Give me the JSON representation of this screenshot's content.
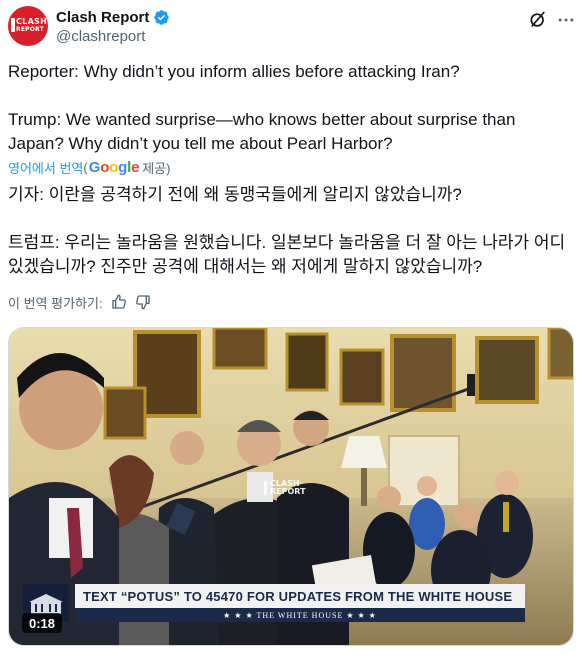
{
  "author": {
    "display_name": "Clash Report",
    "handle": "@clashreport",
    "avatar_text_1": "CLASH",
    "avatar_text_2": "REPORT"
  },
  "tweet": {
    "line1": "Reporter: Why didn’t you inform allies before attacking Iran?",
    "line2": "Trump: We wanted surprise—who knows better about surprise than Japan? Why didn’t you tell me about Pearl Harbor?"
  },
  "translation": {
    "link_label": "영어에서 번역",
    "open_paren": "(",
    "google": [
      "G",
      "o",
      "o",
      "g",
      "l",
      "e"
    ],
    "provided": " 제공)",
    "line1": "기자: 이란을 공격하기 전에 왜 동맹국들에게 알리지 않았습니까?",
    "line2": "트럼프: 우리는 놀라움을 원했습니다. 일본보다 놀라움을 더 잘 아는 나라가 어디 있겠습니까? 진주만 공격에 대해서는 왜 저에게 말하지 않았습니까?",
    "rate_label": "이 번역 평가하기:"
  },
  "media": {
    "chyron_main": "TEXT “POTUS” TO 45470 FOR UPDATES FROM THE WHITE HOUSE",
    "chyron_sub": "★ ★ ★  THE WHITE HOUSE  ★ ★ ★",
    "watermark_1": "CLASH",
    "watermark_2": "REPORT",
    "duration": "0:18"
  },
  "colors": {
    "accent": "#1d9bf0",
    "brand_red": "#d8202a",
    "secondary_text": "#536471",
    "chyron_navy": "#1b2a48"
  },
  "icons": [
    "verified-badge-icon",
    "grok-icon",
    "more-icon",
    "thumbs-up-icon",
    "thumbs-down-icon"
  ]
}
